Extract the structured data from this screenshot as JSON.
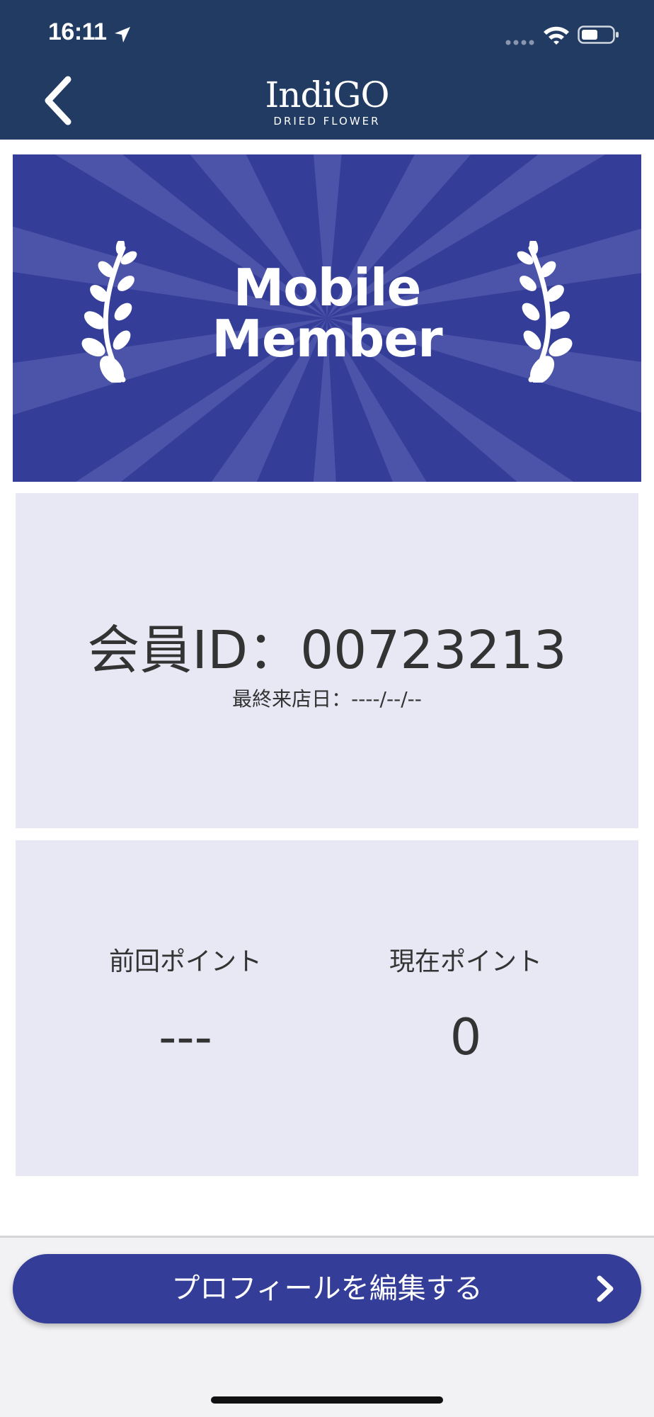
{
  "status_bar": {
    "time": "16:11"
  },
  "header": {
    "logo_main": "IndiGO",
    "logo_sub": "DRIED FLOWER"
  },
  "banner": {
    "title_line1": "Mobile",
    "title_line2": "Member"
  },
  "member": {
    "id_text": "会員ID：00723213",
    "last_visit": "最終来店日：----/--/--"
  },
  "points": {
    "previous_label": "前回ポイント",
    "previous_value": "---",
    "current_label": "現在ポイント",
    "current_value": "0"
  },
  "actions": {
    "edit_profile_label": "プロフィールを編集する"
  },
  "colors": {
    "header_bg": "#213b63",
    "banner_bg": "#343d97",
    "card_bg": "#e8e8f5",
    "button_bg": "#343d97"
  }
}
